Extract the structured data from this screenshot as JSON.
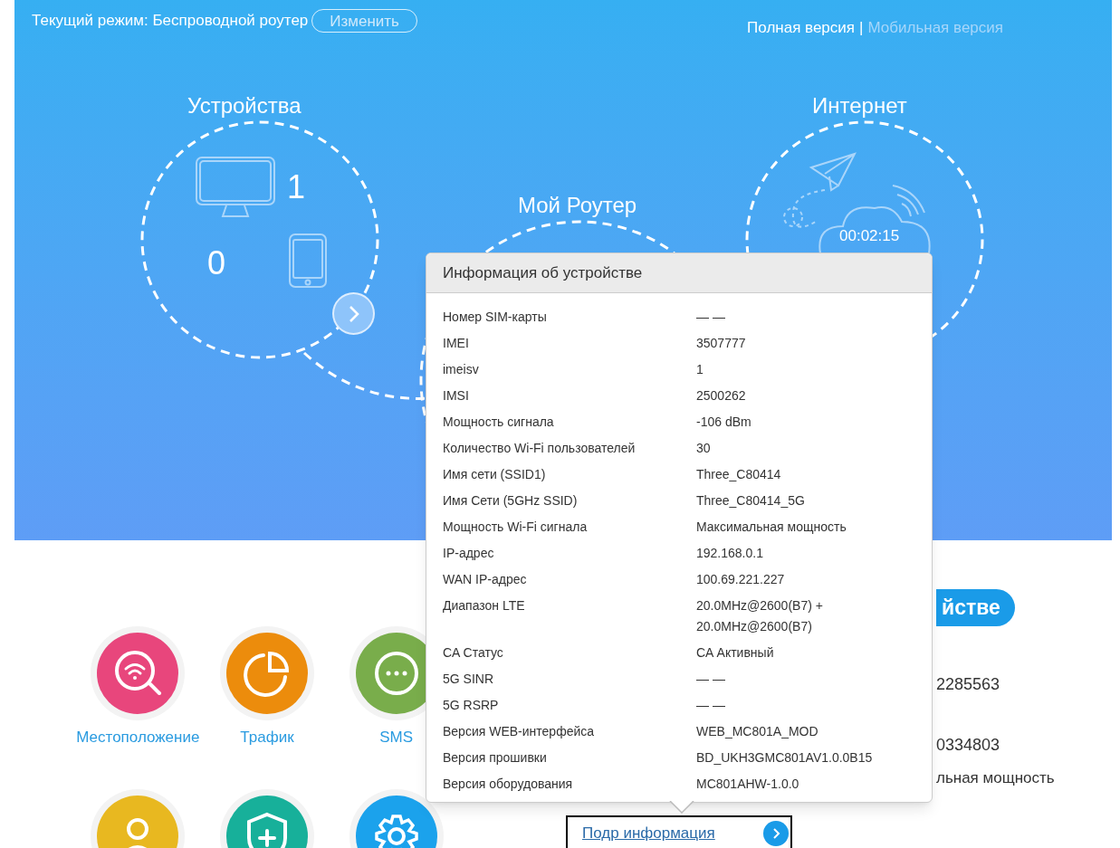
{
  "header": {
    "mode_label": "Текущий режим: Беспроводной роутер",
    "change_button": "Изменить",
    "versions": [
      {
        "label": "Полная версия",
        "selected": true
      },
      {
        "label": "Мобильная версия",
        "selected": false
      }
    ],
    "separator": "|"
  },
  "devices": {
    "title": "Устройства",
    "computers": "1",
    "phones": "0"
  },
  "router": {
    "title": "Мой Роутер"
  },
  "internet": {
    "title": "Интернет",
    "time": "00:02:15"
  },
  "apps": [
    {
      "kind": "location",
      "label": "Местоположение",
      "color": "#e8467c"
    },
    {
      "kind": "traffic",
      "label": "Трафик",
      "color": "#ec8c0c"
    },
    {
      "kind": "sms",
      "label": "SMS",
      "color": "#79ad4b"
    },
    {
      "kind": "user",
      "color": "#e8b820"
    },
    {
      "kind": "shield",
      "color": "#17b09a"
    },
    {
      "kind": "settings",
      "color": "#1ba2ec"
    }
  ],
  "device_info_partial": {
    "button_text": "йстве",
    "values": [
      "2285563",
      "0334803",
      "льная мощность"
    ]
  },
  "details_link": "Подр информация",
  "popup": {
    "title": "Информация об устройстве",
    "rows": [
      {
        "label": "Номер SIM-карты",
        "value": "— —"
      },
      {
        "label": "IMEI",
        "value": "3507777"
      },
      {
        "label": "imeisv",
        "value": "1"
      },
      {
        "label": "IMSI",
        "value": "2500262"
      },
      {
        "label": "Мощность сигнала",
        "value": "-106 dBm"
      },
      {
        "label": "Количество Wi-Fi пользователей",
        "value": "30"
      },
      {
        "label": "Имя сети (SSID1)",
        "value": "Three_C80414"
      },
      {
        "label": "Имя Сети (5GHz SSID)",
        "value": "Three_C80414_5G"
      },
      {
        "label": "Мощность Wi-Fi сигнала",
        "value": "Максимальная мощность"
      },
      {
        "label": "IP-адрес",
        "value": "192.168.0.1"
      },
      {
        "label": "WAN IP-адрес",
        "value": "100.69.221.227"
      },
      {
        "label": "Диапазон LTE",
        "value": "20.0MHz@2600(B7) + 20.0MHz@2600(B7)"
      },
      {
        "label": "CA Статус",
        "value": "CA Активный"
      },
      {
        "label": "5G SINR",
        "value": "— —"
      },
      {
        "label": "5G RSRP",
        "value": "— —"
      },
      {
        "label": "Версия WEB-интерфейса",
        "value": "WEB_MC801A_MOD"
      },
      {
        "label": "Версия прошивки",
        "value": "BD_UKH3GMC801AV1.0.0B15"
      },
      {
        "label": "Версия оборудования",
        "value": "MC801AHW-1.0.0"
      }
    ]
  }
}
